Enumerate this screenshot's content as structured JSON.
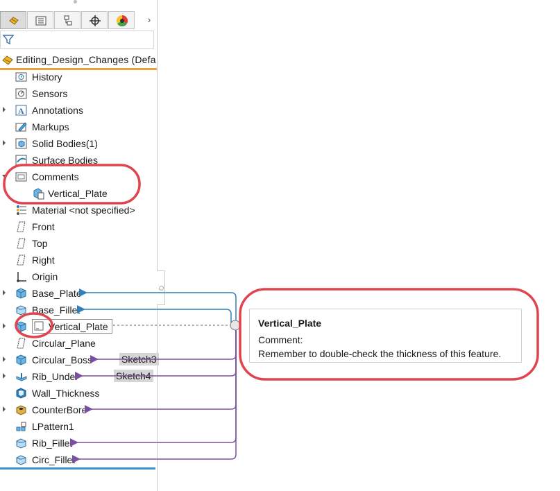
{
  "toolbar": {
    "tabs": [
      {
        "name": "featuremanager-tab",
        "icon": "part-tree-icon"
      },
      {
        "name": "propertymanager-tab",
        "icon": "property-list-icon"
      },
      {
        "name": "configurationmanager-tab",
        "icon": "configuration-icon"
      },
      {
        "name": "dimxpertmanager-tab",
        "icon": "crosshair-icon"
      },
      {
        "name": "displaymanager-tab",
        "icon": "color-wheel-icon"
      }
    ],
    "more_label": "›"
  },
  "filter": {
    "icon": "filter-icon"
  },
  "tree": {
    "root_label": "Editing_Design_Changes  (Defa",
    "items": [
      {
        "label": "History",
        "icon": "history-folder-icon",
        "expander": false
      },
      {
        "label": "Sensors",
        "icon": "sensors-icon",
        "expander": false
      },
      {
        "label": "Annotations",
        "icon": "annotations-icon",
        "expander": true
      },
      {
        "label": "Markups",
        "icon": "markups-icon",
        "expander": false
      },
      {
        "label": "Solid Bodies(1)",
        "icon": "solid-bodies-icon",
        "expander": true
      },
      {
        "label": "Surface Bodies",
        "icon": "surface-bodies-icon",
        "expander": false
      },
      {
        "label": "Comments",
        "icon": "comments-folder-icon",
        "expander": "open"
      },
      {
        "label": "Vertical_Plate",
        "icon": "feature-comment-icon",
        "child": true
      },
      {
        "label": "Material <not specified>",
        "icon": "material-icon",
        "expander": false
      },
      {
        "label": "Front",
        "icon": "plane-icon",
        "expander": false
      },
      {
        "label": "Top",
        "icon": "plane-icon",
        "expander": false
      },
      {
        "label": "Right",
        "icon": "plane-icon",
        "expander": false
      },
      {
        "label": "Origin",
        "icon": "origin-icon",
        "expander": false
      },
      {
        "label": "Base_Plate",
        "icon": "extrude-icon",
        "expander": true
      },
      {
        "label": "Base_Fillet",
        "icon": "fillet-icon",
        "expander": false
      },
      {
        "label": "Vertical_Plate",
        "icon": "extrude-icon",
        "expander": true,
        "selected": true
      },
      {
        "label": "Circular_Plane",
        "icon": "plane-icon",
        "expander": false
      },
      {
        "label": "Circular_Boss",
        "icon": "extrude-icon",
        "expander": true
      },
      {
        "label": "Rib_Under",
        "icon": "rib-icon",
        "expander": true
      },
      {
        "label": "Wall_Thickness",
        "icon": "shell-icon",
        "expander": false
      },
      {
        "label": "CounterBore",
        "icon": "hole-wizard-icon",
        "expander": true
      },
      {
        "label": "LPattern1",
        "icon": "linear-pattern-icon",
        "expander": false
      },
      {
        "label": "Rib_Fillet",
        "icon": "fillet-icon",
        "expander": false
      },
      {
        "label": "Circ_Fillet",
        "icon": "fillet-icon",
        "expander": false
      }
    ]
  },
  "tags": {
    "sketch3": "Sketch3",
    "sketch4": "Sketch4"
  },
  "tooltip": {
    "title": "Vertical_Plate",
    "line1": "Comment:",
    "line2": "Remember to double-check the thickness of this feature."
  },
  "colors": {
    "highlight_red": "#e0444e",
    "parent_link_blue": "#2f7fb8",
    "child_link_purple": "#7a4ea0",
    "root_underline": "#e8a43a",
    "rollback_blue": "#3a8fd0"
  }
}
